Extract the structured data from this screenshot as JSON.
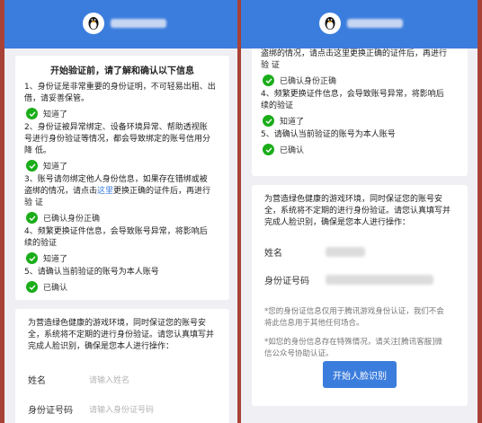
{
  "intro": {
    "title": "开始验证前，请了解和确认以下信息",
    "item1": [
      "1、身份证是非常重要的身份证明，不可轻易出租、出",
      "借，请妥善保管。"
    ],
    "item2": [
      "2、身份证被异常绑定、设备环境异常、帮助透视账",
      "号进行身份验证等情况，都会导致绑定的账号信用分",
      "降 低。"
    ],
    "item3_pre": "3、账号请勿绑定他人身份信息，如果存在错绑或被",
    "item3_mid_a": "盗绑的情况，请点击",
    "item3_link": "这里",
    "item3_mid_b": "更换正确的证件后，再进行",
    "item3_end": "验 证",
    "item4": [
      "4、频繁更换证件信息，会导致账号异常，将影响后",
      "续的验证"
    ],
    "item5": "5、请确认当前验证的账号为本人账号",
    "ack1": "知道了",
    "ack2": "知道了",
    "ack3": "已确认身份正确",
    "ack4": "知道了",
    "ack5": "已确认"
  },
  "verify": {
    "desc": [
      "为营造绿色健康的游戏环境，同时保证您的账号安",
      "全，系统将不定期的进行身份验证。请您认真填写并",
      "完成人脸识别，确保是您本人进行操作："
    ],
    "name_label": "姓名",
    "name_placeholder": "请输入姓名",
    "id_label": "身份证号码",
    "id_placeholder": "请输入身份证号码",
    "note1": [
      "*您的身份证信息仅用于腾讯游戏身份认证，我们不会",
      "将此信息用于其他任何场合。"
    ],
    "note2": [
      "*如您的身份信息存在特殊情况，请关注[腾讯客服]微",
      "信公众号协助认证。"
    ],
    "button": "开始人脸识别"
  },
  "right_top": {
    "cut_line": "盗绑的情况，请点击这里更换正确的证件后，再进行",
    "cut_line_end": "验 证"
  },
  "colors": {
    "accent": "#3b7ddd",
    "check": "#1aad19",
    "background": "#a84236"
  },
  "icons": [
    "qq-penguin-icon",
    "checkmark-icon"
  ]
}
